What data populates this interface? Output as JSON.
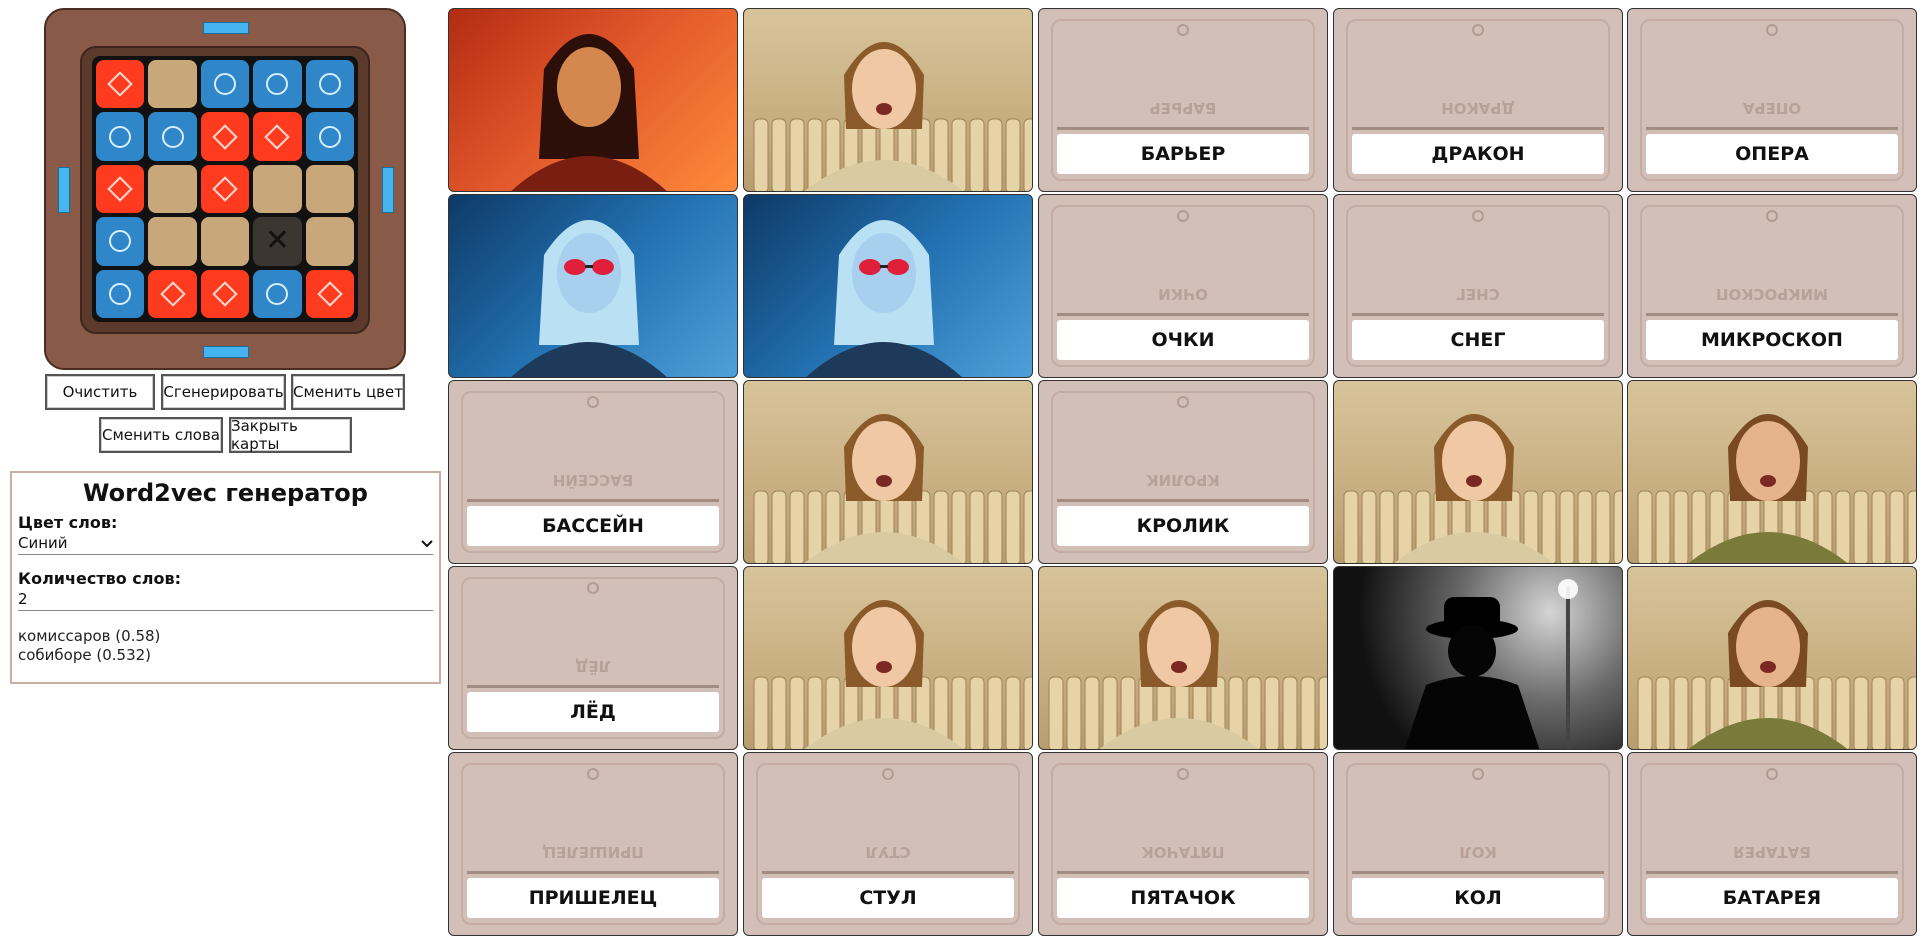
{
  "key_card": {
    "rows": [
      [
        "red",
        "neutral",
        "blue",
        "blue",
        "blue"
      ],
      [
        "blue",
        "blue",
        "red",
        "red",
        "blue"
      ],
      [
        "red",
        "neutral",
        "red",
        "neutral",
        "neutral"
      ],
      [
        "blue",
        "neutral",
        "neutral",
        "assassin",
        "neutral"
      ],
      [
        "blue",
        "red",
        "red",
        "blue",
        "red"
      ]
    ],
    "colors": {
      "red": "#ff3b1f",
      "blue": "#2f87c9",
      "neutral": "#c8a87a",
      "assassin": "#3c3632"
    }
  },
  "buttons": {
    "clear": "Очистить",
    "generate": "Сгенерировать",
    "change_color": "Сменить цвет",
    "change_words": "Сменить слова",
    "close_cards": "Закрыть карты"
  },
  "generator": {
    "title": "Word2vec генератор",
    "color_label": "Цвет слов:",
    "color_value": "Синий",
    "count_label": "Количество слов:",
    "count_value": "2",
    "results": [
      "комиссаров (0.58)",
      "собиборе (0.532)"
    ]
  },
  "board": [
    {
      "kind": "agent",
      "team": "red",
      "icon": "woman-agent-icon"
    },
    {
      "kind": "agent",
      "team": "neutral",
      "icon": "bystander-woman-icon"
    },
    {
      "kind": "word",
      "text": "БАРЬЕР"
    },
    {
      "kind": "word",
      "text": "ДРАКОН"
    },
    {
      "kind": "word",
      "text": "ОПЕРА"
    },
    {
      "kind": "agent",
      "team": "blue",
      "icon": "woman-agent-icon"
    },
    {
      "kind": "agent",
      "team": "blue",
      "icon": "woman-agent-icon"
    },
    {
      "kind": "word",
      "text": "ОЧКИ"
    },
    {
      "kind": "word",
      "text": "СНЕГ"
    },
    {
      "kind": "word",
      "text": "МИКРОСКОП"
    },
    {
      "kind": "word",
      "text": "БАССЕЙН"
    },
    {
      "kind": "agent",
      "team": "neutral",
      "icon": "bystander-woman-icon"
    },
    {
      "kind": "word",
      "text": "КРОЛИК"
    },
    {
      "kind": "agent",
      "team": "neutral",
      "icon": "bystander-woman-icon"
    },
    {
      "kind": "agent",
      "team": "neutral",
      "icon": "bystander-man-icon"
    },
    {
      "kind": "word",
      "text": "ЛЁД"
    },
    {
      "kind": "agent",
      "team": "neutral",
      "icon": "bystander-woman-icon"
    },
    {
      "kind": "agent",
      "team": "neutral",
      "icon": "bystander-woman-icon"
    },
    {
      "kind": "agent",
      "team": "assassin",
      "icon": "assassin-silhouette-icon"
    },
    {
      "kind": "agent",
      "team": "neutral",
      "icon": "bystander-man-icon"
    },
    {
      "kind": "word",
      "text": "ПРИШЕЛЕЦ"
    },
    {
      "kind": "word",
      "text": "СТУЛ"
    },
    {
      "kind": "word",
      "text": "ПЯТАЧОК"
    },
    {
      "kind": "word",
      "text": "КОЛ"
    },
    {
      "kind": "word",
      "text": "БАТАРЕЯ"
    }
  ]
}
